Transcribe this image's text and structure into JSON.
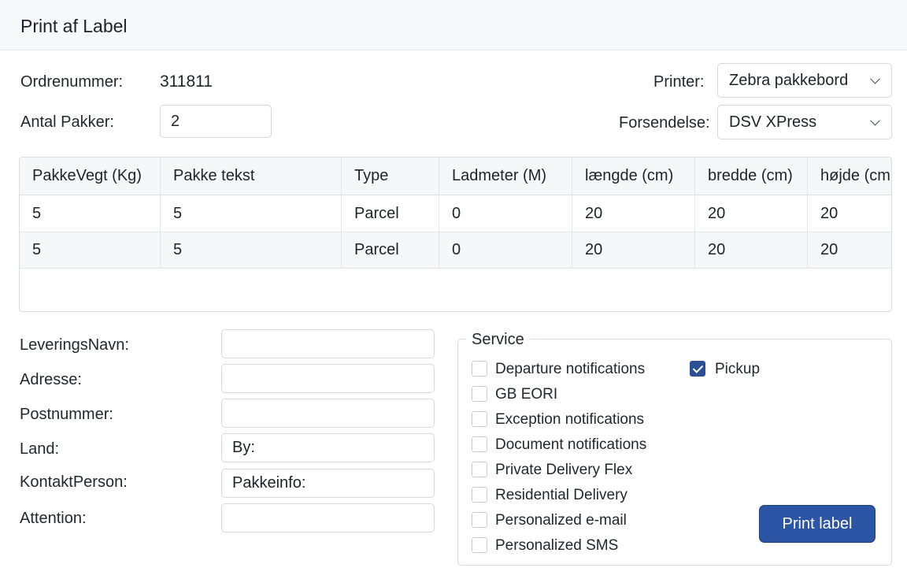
{
  "window": {
    "title": "Print af Label"
  },
  "order": {
    "ordrenummer_label": "Ordrenummer:",
    "ordrenummer_value": "311811",
    "antal_label": "Antal Pakker:",
    "antal_value": "2",
    "printer_label": "Printer:",
    "printer_value": "Zebra pakkebord",
    "forsendelse_label": "Forsendelse:",
    "forsendelse_value": "DSV XPress"
  },
  "table": {
    "columns": [
      "PakkeVegt (Kg)",
      "Pakke tekst",
      "Type",
      "Ladmeter (M)",
      "længde (cm)",
      "bredde (cm)",
      "højde (cm"
    ],
    "rows": [
      [
        "5",
        "5",
        "Parcel",
        "0",
        "20",
        "20",
        "20"
      ],
      [
        "5",
        "5",
        "Parcel",
        "0",
        "20",
        "20",
        "20"
      ]
    ]
  },
  "delivery": {
    "fields": [
      {
        "label": "LeveringsNavn:",
        "value": ""
      },
      {
        "label": "Adresse:",
        "value": ""
      },
      {
        "label": "Postnummer:",
        "value": ""
      },
      {
        "label": "Land:",
        "value": "By:"
      },
      {
        "label": "KontaktPerson:",
        "value": "Pakkeinfo:"
      },
      {
        "label": "Attention:",
        "value": ""
      }
    ]
  },
  "service": {
    "title": "Service",
    "options": [
      {
        "label": "Departure notifications",
        "checked": false
      },
      {
        "label": "GB EORI",
        "checked": false
      },
      {
        "label": "Exception notifications",
        "checked": false
      },
      {
        "label": "Document notifications",
        "checked": false
      },
      {
        "label": "Private Delivery Flex",
        "checked": false
      },
      {
        "label": "Residential Delivery",
        "checked": false
      },
      {
        "label": "Personalized e-mail",
        "checked": false
      },
      {
        "label": "Personalized SMS",
        "checked": false
      }
    ],
    "pickup": {
      "label": "Pickup",
      "checked": true
    }
  },
  "actions": {
    "print_label": "Print label"
  },
  "icons": {
    "dropdown": "chevron-down-icon",
    "checkbox_checked": "check-icon"
  },
  "colors": {
    "primary_button": "#2d55a5",
    "checkbox_checked": "#2c4f94"
  }
}
